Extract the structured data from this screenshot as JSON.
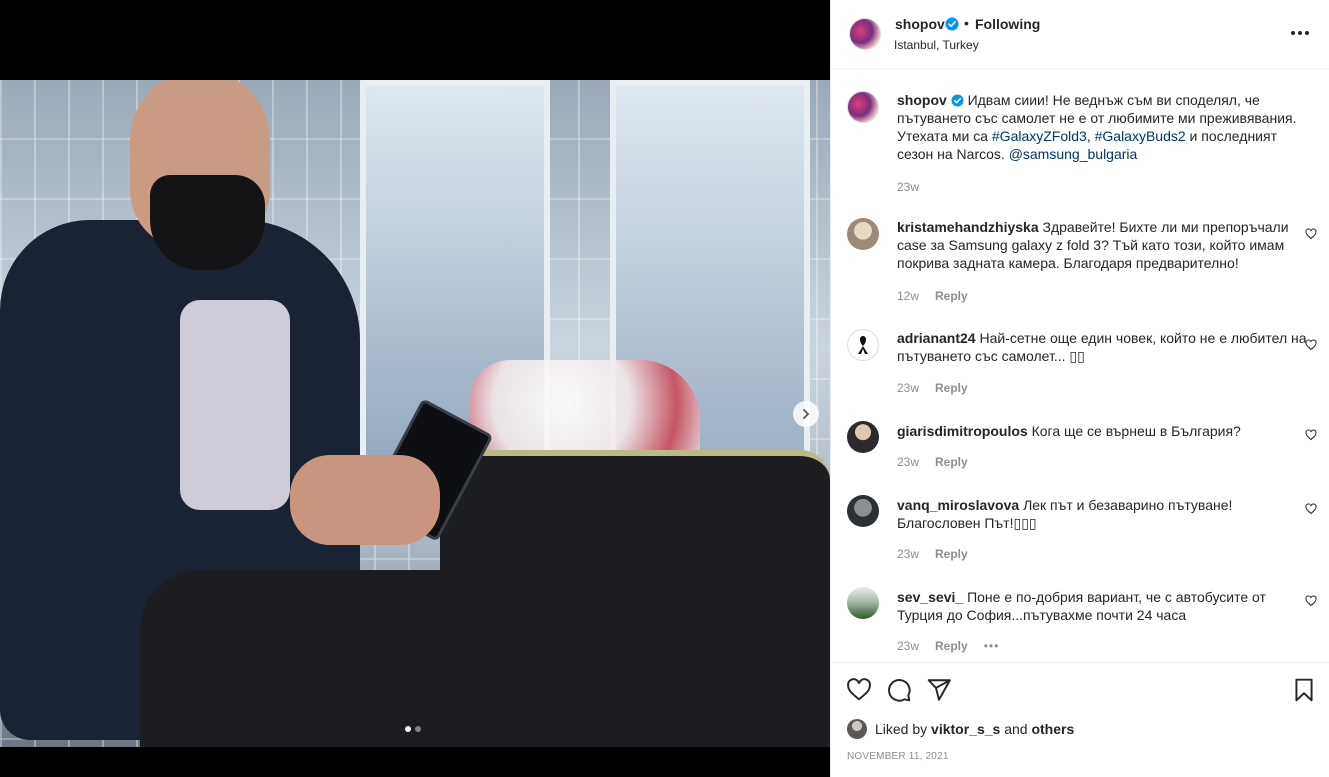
{
  "post": {
    "username": "shopov",
    "follow_label": "Following",
    "separator": "•",
    "location": "Istanbul, Turkey",
    "caption_user": "shopov",
    "caption_part1": "Идвам сиии! Не веднъж съм ви споделял, че пътуването със самолет не е от любимите ми преживявания. Утехата ми са ",
    "tag1": "#GalaxyZFold3",
    "caption_sep": ", ",
    "tag2": "#GalaxyBuds2",
    "caption_part2": " и последният сезон на Narcos. ",
    "mention": "@samsung_bulgaria",
    "caption_time": "23w",
    "liked_by_prefix": "Liked by ",
    "liked_by_user": "viktor_s_s",
    "liked_by_and": " and ",
    "liked_by_others": "others",
    "date": "NOVEMBER 11, 2021",
    "accent": "#0095f6"
  },
  "comments": [
    {
      "user": "kristamehandzhiyska",
      "text": "Здравейте! Бихте ли ми препоръчали case за Samsung galaxy z fold 3? Тъй като този, който имам покрива задната камера. Благодаря предварително!",
      "time": "12w",
      "reply": "Reply"
    },
    {
      "user": "adrianant24",
      "text": "Най-сетне още един човек, който не е любител на пътуването със самолет... ▯▯",
      "time": "23w",
      "reply": "Reply"
    },
    {
      "user": "giarisdimitropoulos",
      "text": "Кога ще се върнеш в България?",
      "time": "23w",
      "reply": "Reply"
    },
    {
      "user": "vanq_miroslavova",
      "text": "Лек път и безаварино пътуване! Благословен Път!▯▯▯",
      "time": "23w",
      "reply": "Reply"
    },
    {
      "user": "sev_sevi_",
      "text": "Поне е по-добрия вариант, че с автобусите от Турция до София...пътувахме почти 24 часа",
      "time": "23w",
      "reply": "Reply",
      "more": "•••"
    }
  ],
  "carousel": {
    "current_slide": 1,
    "total_slides": 2
  },
  "icons": [
    "verified-badge-icon",
    "more-options-icon",
    "heart-icon",
    "comment-icon",
    "share-icon",
    "bookmark-icon",
    "chevron-right-icon"
  ]
}
